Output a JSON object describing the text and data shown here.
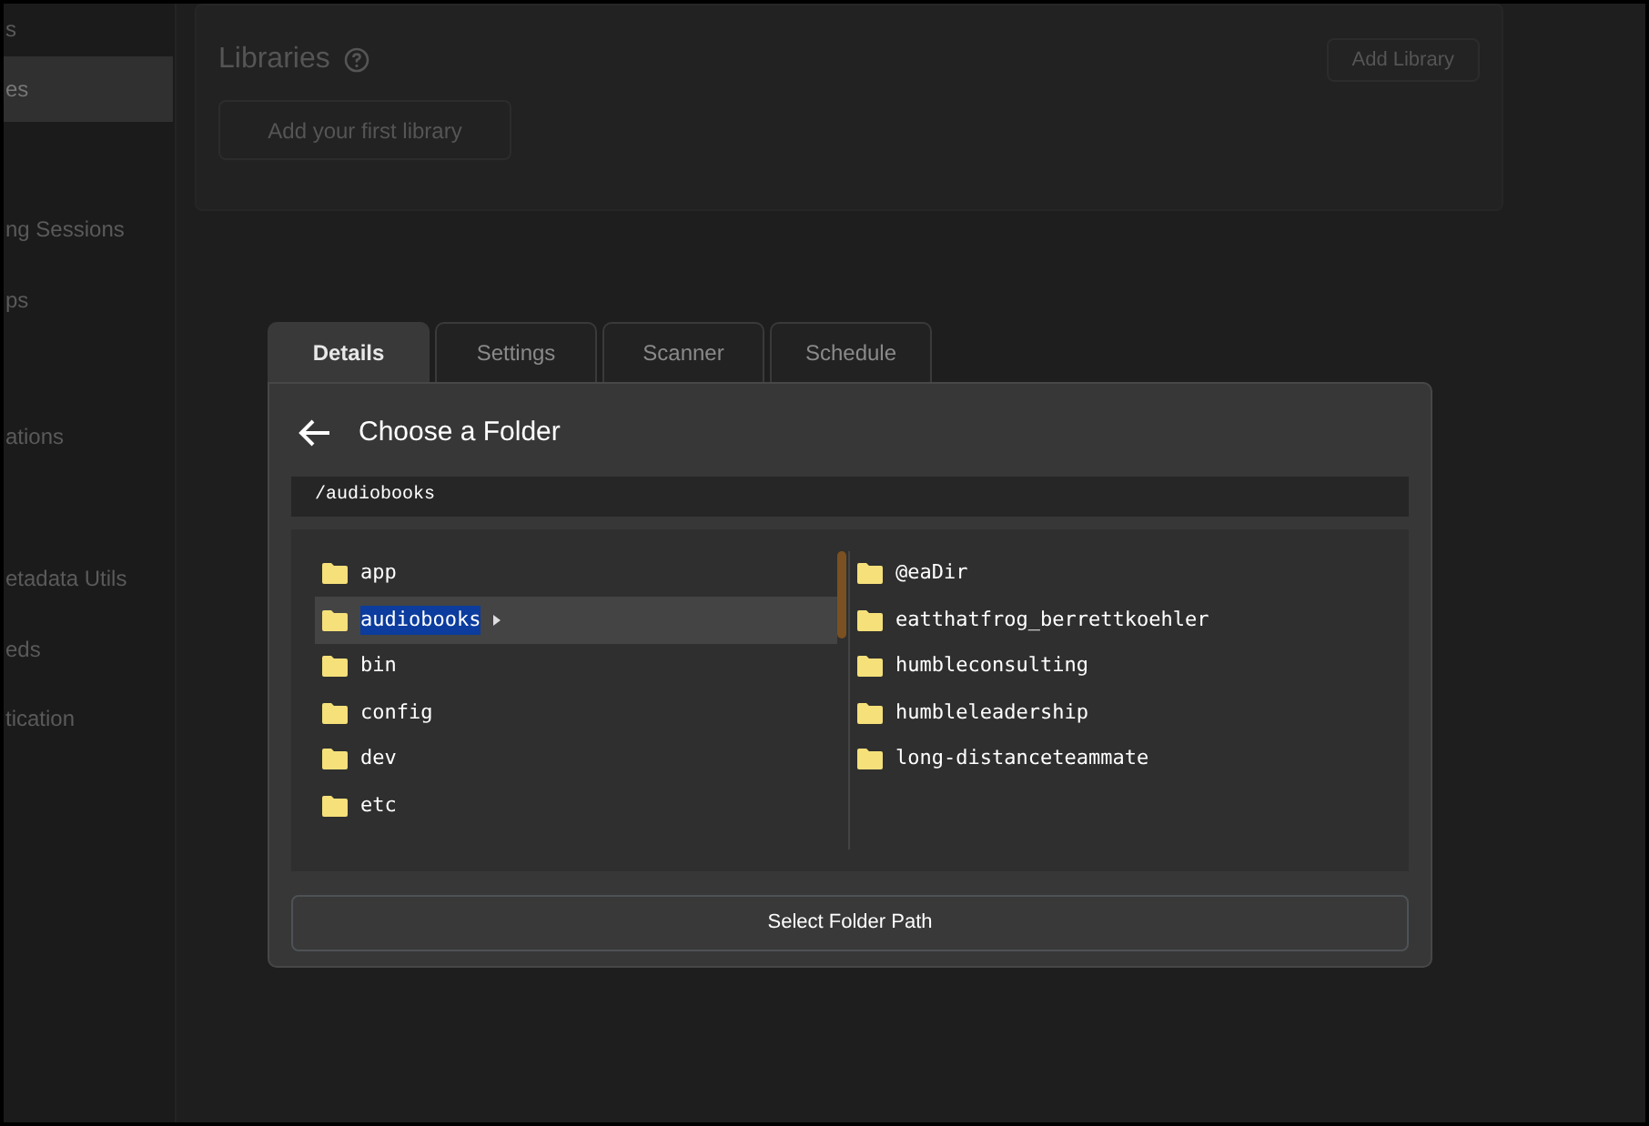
{
  "sidebar": {
    "items": [
      {
        "label": "s",
        "selected": false
      },
      {
        "label": "es",
        "selected": true
      },
      {
        "label": "ng Sessions",
        "selected": false
      },
      {
        "label": "ps",
        "selected": false
      },
      {
        "label": "ations",
        "selected": false
      },
      {
        "label": "etadata Utils",
        "selected": false
      },
      {
        "label": "eds",
        "selected": false
      },
      {
        "label": "tication",
        "selected": false
      }
    ]
  },
  "libraries": {
    "title": "Libraries",
    "add_button": "Add Library",
    "first_button": "Add your first library"
  },
  "modal": {
    "tabs": [
      {
        "label": "Details",
        "selected": true
      },
      {
        "label": "Settings",
        "selected": false
      },
      {
        "label": "Scanner",
        "selected": false
      },
      {
        "label": "Schedule",
        "selected": false
      }
    ],
    "title": "Choose a Folder",
    "path": "/audiobooks",
    "left_folders": [
      {
        "name": "app",
        "selected": false
      },
      {
        "name": "audiobooks",
        "selected": true
      },
      {
        "name": "bin",
        "selected": false
      },
      {
        "name": "config",
        "selected": false
      },
      {
        "name": "dev",
        "selected": false
      },
      {
        "name": "etc",
        "selected": false
      }
    ],
    "right_folders": [
      {
        "name": "@eaDir"
      },
      {
        "name": "eatthatfrog_berrettkoehler"
      },
      {
        "name": "humbleconsulting"
      },
      {
        "name": "humbleleadership"
      },
      {
        "name": "long-distanceteammate"
      }
    ],
    "select_button": "Select Folder Path"
  }
}
